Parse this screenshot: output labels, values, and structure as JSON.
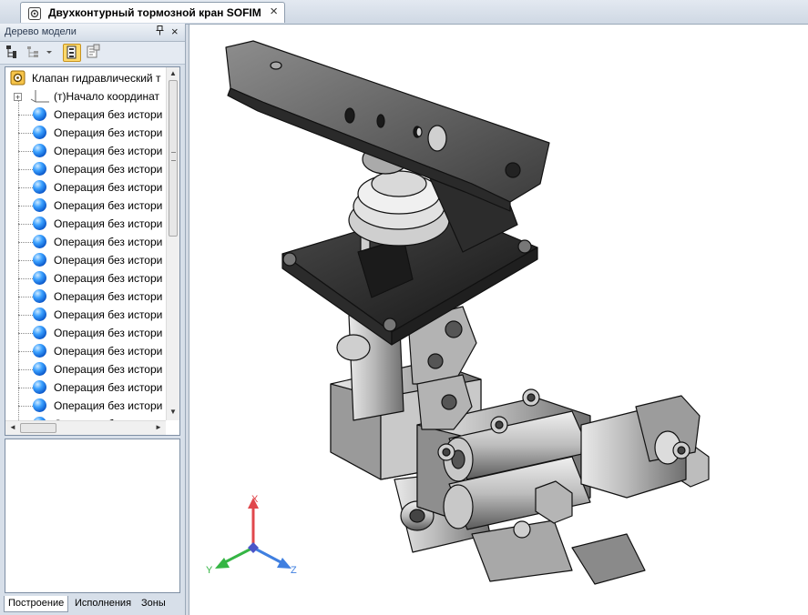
{
  "document_tab": {
    "title": "Двухконтурный тормозной кран SOFIM",
    "close_glyph": "×",
    "icon": "assembly-document-icon"
  },
  "model_tree_panel": {
    "title": "Дерево модели",
    "pin_glyph": "ᵖ",
    "close_glyph": "×",
    "toolbar_icons": [
      "tree-structure-icon",
      "tree-filter-icon",
      "tree-view-mode-icon",
      "tree-properties-icon"
    ],
    "root": {
      "label": "Клапан гидравлический т",
      "icon": "assembly-icon"
    },
    "origin": {
      "expander": "+",
      "label": "(т)Начало координат",
      "icon": "origin-icon"
    },
    "operations": [
      "Операция без истори",
      "Операция без истори",
      "Операция без истори",
      "Операция без истори",
      "Операция без истори",
      "Операция без истори",
      "Операция без истори",
      "Операция без истори",
      "Операция без истори",
      "Операция без истори",
      "Операция без истори",
      "Операция без истори",
      "Операция без истори",
      "Операция без истори",
      "Операция без истори",
      "Операция без истори",
      "Операция без истори",
      "Операция без истори"
    ],
    "operation_icon": "body-sphere-icon",
    "scroll_up": "▲",
    "scroll_down": "▼",
    "scroll_left": "◄",
    "scroll_right": "►",
    "bottom_tabs": [
      "Построение",
      "Исполнения",
      "Зоны"
    ]
  },
  "viewport": {
    "axes": {
      "x_label": "X",
      "y_label": "Y",
      "z_label": "Z"
    },
    "colors": {
      "x_axis": "#e0474c",
      "y_axis": "#35b544",
      "z_axis": "#3f7fe0",
      "origin": "#4a55c9"
    }
  }
}
